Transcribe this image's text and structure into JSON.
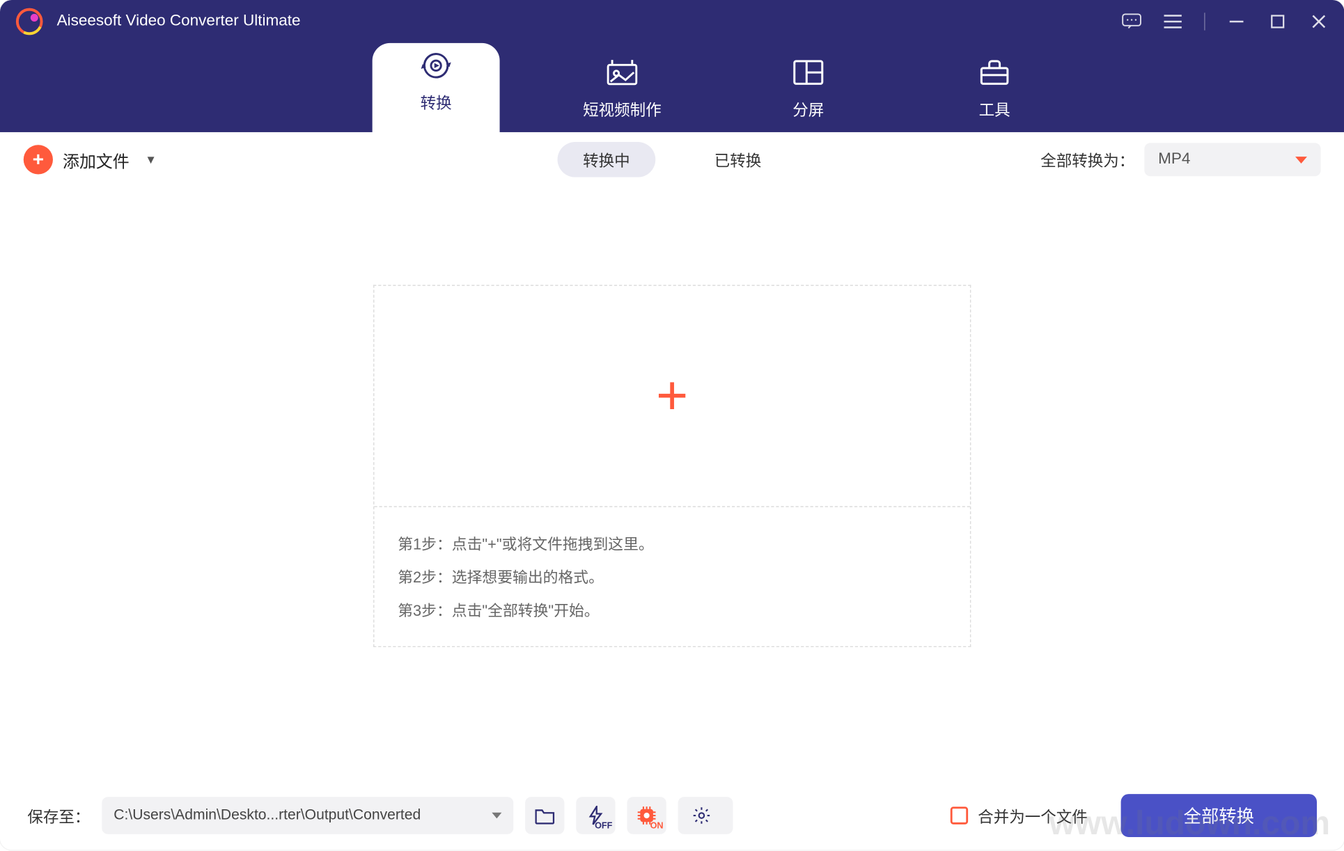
{
  "app": {
    "title": "Aiseesoft Video Converter Ultimate"
  },
  "nav": {
    "convert": "转换",
    "mv": "短视频制作",
    "collage": "分屏",
    "toolbox": "工具"
  },
  "toolbar": {
    "add_files": "添加文件",
    "tab_converting": "转换中",
    "tab_converted": "已转换",
    "convert_all_to": "全部转换为：",
    "format": "MP4"
  },
  "steps": {
    "s1": "第1步：点击\"+\"或将文件拖拽到这里。",
    "s2": "第2步：选择想要输出的格式。",
    "s3": "第3步：点击\"全部转换\"开始。"
  },
  "bottom": {
    "save_to": "保存至：",
    "path": "C:\\Users\\Admin\\Deskto...rter\\Output\\Converted",
    "flash_label": "OFF",
    "gpu_label": "ON",
    "merge": "合并为一个文件",
    "convert_all": "全部转换"
  },
  "watermark": "www.ludown.com"
}
